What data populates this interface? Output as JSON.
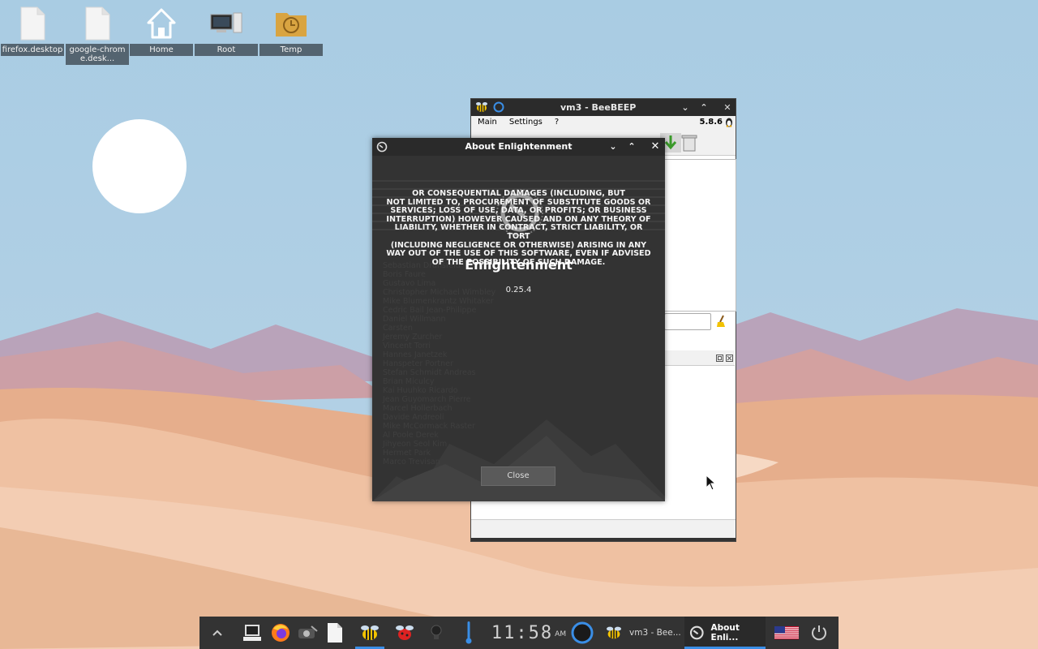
{
  "desktop": {
    "icons": [
      {
        "label": "firefox.desktop",
        "icon": "file-icon"
      },
      {
        "label": "google-chrome.desk...",
        "icon": "file-icon"
      },
      {
        "label": "Home",
        "icon": "home-icon"
      },
      {
        "label": "Root",
        "icon": "computer-icon"
      },
      {
        "label": "Temp",
        "icon": "folder-clock-icon"
      }
    ]
  },
  "beebeep": {
    "title": "vm3 - BeeBEEP",
    "menu": [
      "Main",
      "Settings",
      "?"
    ],
    "version": "5.8.6"
  },
  "about": {
    "title": "About Enlightenment",
    "license_lines": [
      "OR CONSEQUENTIAL DAMAGES (INCLUDING, BUT",
      "NOT LIMITED TO, PROCUREMENT OF SUBSTITUTE GOODS OR",
      "SERVICES; LOSS OF USE, DATA, OR PROFITS; OR BUSINESS",
      "INTERRUPTION) HOWEVER CAUSED AND ON ANY THEORY OF",
      "LIABILITY, WHETHER IN CONTRACT, STRICT LIABILITY, OR TORT",
      "(INCLUDING NEGLIGENCE OR OTHERWISE) ARISING IN ANY",
      "WAY OUT OF THE USE OF THIS SOFTWARE, EVEN IF ADVISED",
      "OF THE POSSIBILITY OF SUCH DAMAGE."
    ],
    "app_name": "Enlightenment",
    "app_version": "0.25.4",
    "close_label": "Close"
  },
  "taskbar": {
    "clock": {
      "digits": "11:58",
      "ampm": "AM"
    },
    "tasks": [
      {
        "label": "vm3 - Bee...",
        "icon": "bee-icon",
        "active": false
      },
      {
        "label": "About Enli...",
        "icon": "enlightenment-icon",
        "active": true
      }
    ],
    "accent_color": "#3a8ee6"
  }
}
